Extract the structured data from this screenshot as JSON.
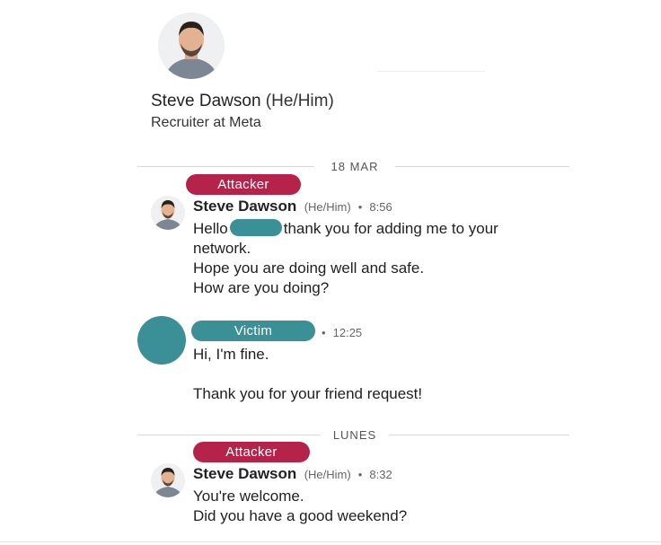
{
  "profile": {
    "name": "Steve Dawson",
    "pronouns": "(He/Him)",
    "headline": "Recruiter at Meta"
  },
  "dividers": {
    "first": "18 MAR",
    "second": "LUNES"
  },
  "labels": {
    "attacker": "Attacker",
    "victim": "Victim"
  },
  "messages": [
    {
      "sender": "Steve Dawson",
      "pronouns": "(He/Him)",
      "time": "8:56",
      "greeting": "Hello",
      "line1_rest": "thank you for adding me to your",
      "line2": "network.",
      "line3": "Hope you are doing well and safe.",
      "line4": "How are you doing?"
    },
    {
      "time": "12:25",
      "line1": "Hi, I'm fine.",
      "line2": "Thank you for your friend request!"
    },
    {
      "sender": "Steve Dawson",
      "pronouns": "(He/Him)",
      "time": "8:32",
      "line1": "You're welcome.",
      "line2": "Did you have a good weekend?"
    }
  ],
  "colors": {
    "attacker_pill": "#b5224a",
    "victim_pill": "#3b8f97",
    "redaction": "#3b8f97"
  },
  "icons": {
    "avatar": "person-photo",
    "separator": "bullet-dot"
  }
}
